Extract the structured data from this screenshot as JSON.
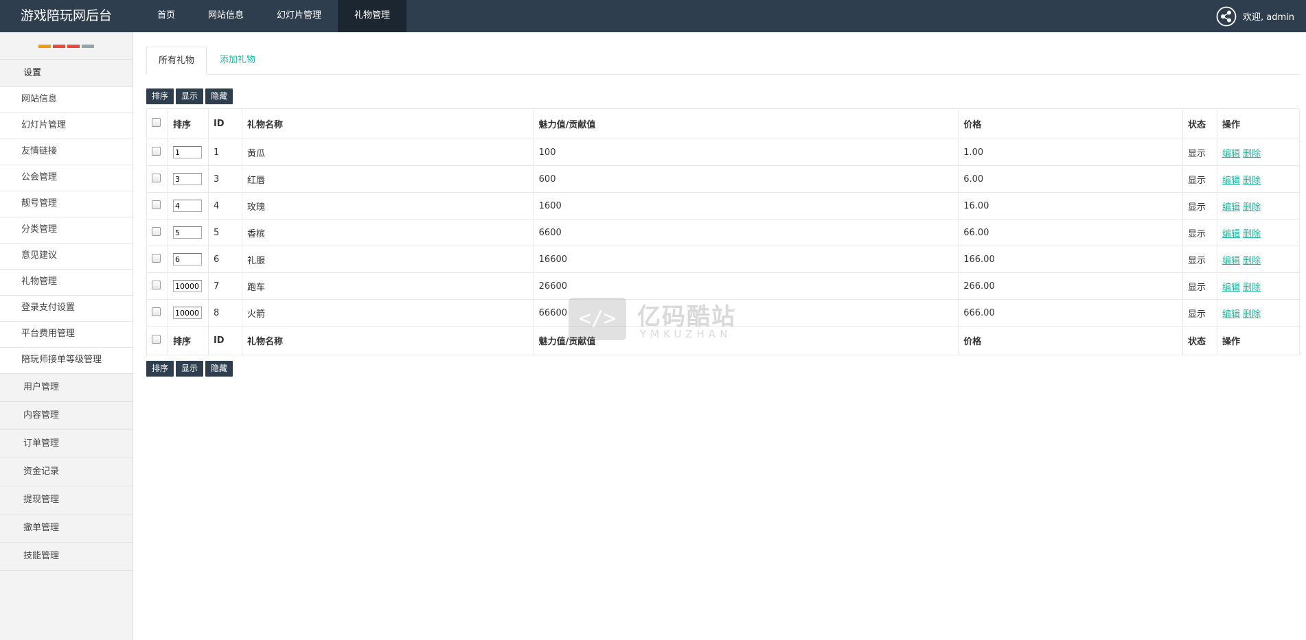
{
  "app": {
    "brand": "游戏陪玩网后台"
  },
  "topnav": {
    "items": [
      {
        "label": "首页"
      },
      {
        "label": "网站信息"
      },
      {
        "label": "幻灯片管理"
      },
      {
        "label": "礼物管理",
        "active": true
      }
    ]
  },
  "user": {
    "greeting": "欢迎, admin",
    "icon": "share-icon"
  },
  "sidebar": {
    "indicator_colors": [
      "#f39c12",
      "#e74c3c",
      "#e74c3c",
      "#95a5a6"
    ],
    "section_title": "设置",
    "sub_items": [
      {
        "label": "网站信息"
      },
      {
        "label": "幻灯片管理"
      },
      {
        "label": "友情链接"
      },
      {
        "label": "公会管理"
      },
      {
        "label": "靓号管理"
      },
      {
        "label": "分类管理"
      },
      {
        "label": "意见建议"
      },
      {
        "label": "礼物管理"
      },
      {
        "label": "登录支付设置"
      },
      {
        "label": "平台费用管理"
      },
      {
        "label": "陪玩师接单等级管理"
      }
    ],
    "main_items": [
      {
        "label": "用户管理"
      },
      {
        "label": "内容管理"
      },
      {
        "label": "订单管理"
      },
      {
        "label": "资金记录"
      },
      {
        "label": "提现管理"
      },
      {
        "label": "撤单管理"
      },
      {
        "label": "技能管理"
      }
    ]
  },
  "tabs": {
    "all_gifts": "所有礼物",
    "add_gift": "添加礼物"
  },
  "actions": {
    "sort": "排序",
    "show": "显示",
    "hide": "隐藏"
  },
  "table": {
    "headers": {
      "sort": "排序",
      "id": "ID",
      "name": "礼物名称",
      "charm": "魅力值/贡献值",
      "price": "价格",
      "status": "状态",
      "ops": "操作"
    },
    "edit_label": "编辑",
    "delete_label": "删除",
    "rows": [
      {
        "sort": "1",
        "id": "1",
        "name": "黄瓜",
        "charm": "100",
        "price": "1.00",
        "status": "显示"
      },
      {
        "sort": "3",
        "id": "3",
        "name": "红唇",
        "charm": "600",
        "price": "6.00",
        "status": "显示"
      },
      {
        "sort": "4",
        "id": "4",
        "name": "玫瑰",
        "charm": "1600",
        "price": "16.00",
        "status": "显示"
      },
      {
        "sort": "5",
        "id": "5",
        "name": "香槟",
        "charm": "6600",
        "price": "66.00",
        "status": "显示"
      },
      {
        "sort": "6",
        "id": "6",
        "name": "礼服",
        "charm": "16600",
        "price": "166.00",
        "status": "显示"
      },
      {
        "sort": "10000",
        "id": "7",
        "name": "跑车",
        "charm": "26600",
        "price": "266.00",
        "status": "显示"
      },
      {
        "sort": "10000",
        "id": "8",
        "name": "火箭",
        "charm": "66600",
        "price": "666.00",
        "status": "显示"
      }
    ]
  },
  "watermark": {
    "title": "亿码酷站",
    "subtitle": "YMKUZHAN",
    "logo_glyph": "</>"
  },
  "colors": {
    "topbar": "#2e3e4e",
    "accent": "#1abc9c",
    "button": "#2e3e4e"
  }
}
